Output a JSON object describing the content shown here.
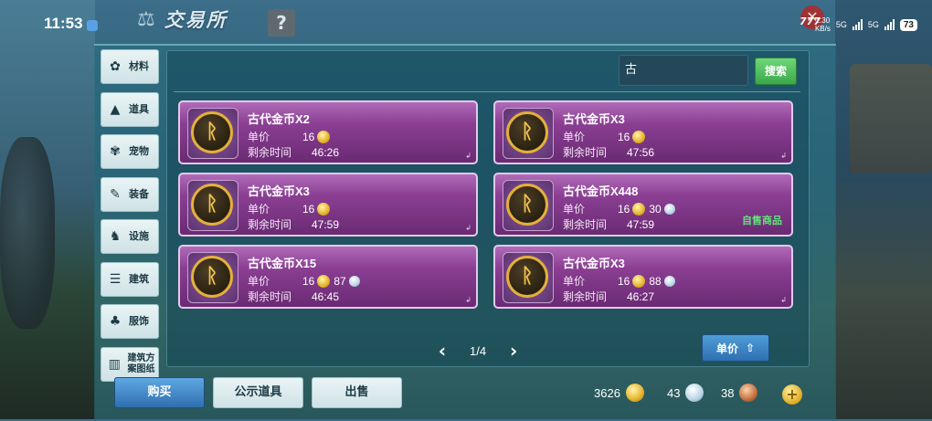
{
  "status_bar": {
    "time": "11:53",
    "net_speed_value": "1.30",
    "net_speed_unit": "KB/s",
    "signal1": "5G",
    "signal2": "5G",
    "battery": "73",
    "badge": "777"
  },
  "header": {
    "title": "交易所",
    "help": "?"
  },
  "sidebar": {
    "items": [
      {
        "label": "材料",
        "icon": "materials-icon"
      },
      {
        "label": "道具",
        "icon": "flask-icon"
      },
      {
        "label": "宠物",
        "icon": "paw-icon"
      },
      {
        "label": "装备",
        "icon": "equipment-icon"
      },
      {
        "label": "设施",
        "icon": "facility-icon"
      },
      {
        "label": "建筑",
        "icon": "building-icon"
      },
      {
        "label": "服饰",
        "icon": "clothing-icon"
      },
      {
        "label": "建筑方案图纸",
        "icon": "blueprint-icon"
      }
    ]
  },
  "search": {
    "value": "古",
    "button": "搜索"
  },
  "listing_labels": {
    "price": "单价",
    "time_left": "剩余时间"
  },
  "listings": [
    {
      "name": "古代金币X2",
      "gold": "16",
      "silver": "",
      "time": "46:26",
      "tag": ""
    },
    {
      "name": "古代金币X3",
      "gold": "16",
      "silver": "",
      "time": "47:56",
      "tag": ""
    },
    {
      "name": "古代金币X3",
      "gold": "16",
      "silver": "",
      "time": "47:59",
      "tag": ""
    },
    {
      "name": "古代金币X448",
      "gold": "16",
      "silver": "30",
      "time": "47:59",
      "tag": "自售商品"
    },
    {
      "name": "古代金币X15",
      "gold": "16",
      "silver": "87",
      "time": "46:45",
      "tag": ""
    },
    {
      "name": "古代金币X3",
      "gold": "16",
      "silver": "88",
      "time": "46:27",
      "tag": ""
    }
  ],
  "pager": {
    "page": "1/4"
  },
  "sort_button": "单价",
  "bottom": {
    "buy": "购买",
    "public": "公示道具",
    "sell": "出售"
  },
  "currency": {
    "gold": "3626",
    "silver": "43",
    "copper": "38"
  },
  "colors": {
    "card_purple": "#8b3f93",
    "self_sale_green": "#5fe37b",
    "search_green": "#3aa84a",
    "primary_blue": "#2f6fb0"
  }
}
